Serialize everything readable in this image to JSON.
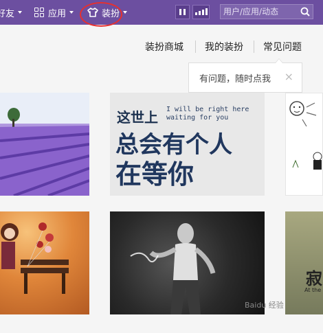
{
  "topbar": {
    "friends_label": "好友",
    "apps_label": "应用",
    "dress_label": "装扮",
    "search_placeholder": "用户/应用/动态",
    "bg_color": "#6c4fa0",
    "highlight_color": "#e53030"
  },
  "subnav": {
    "items": [
      {
        "label": "装扮商城"
      },
      {
        "label": "我的装扮"
      },
      {
        "label": "常见问题"
      }
    ]
  },
  "tooltip": {
    "text": "有问题，随时点我",
    "close": "×"
  },
  "cards": {
    "card2": {
      "line1": "这世上",
      "line2a": "I will be right here",
      "line2b": "waiting for you",
      "line3": "总会有个人",
      "line4": "在等你"
    },
    "card6": {
      "big": "寂",
      "small": "At the"
    }
  },
  "watermark": "Baidu 经验"
}
